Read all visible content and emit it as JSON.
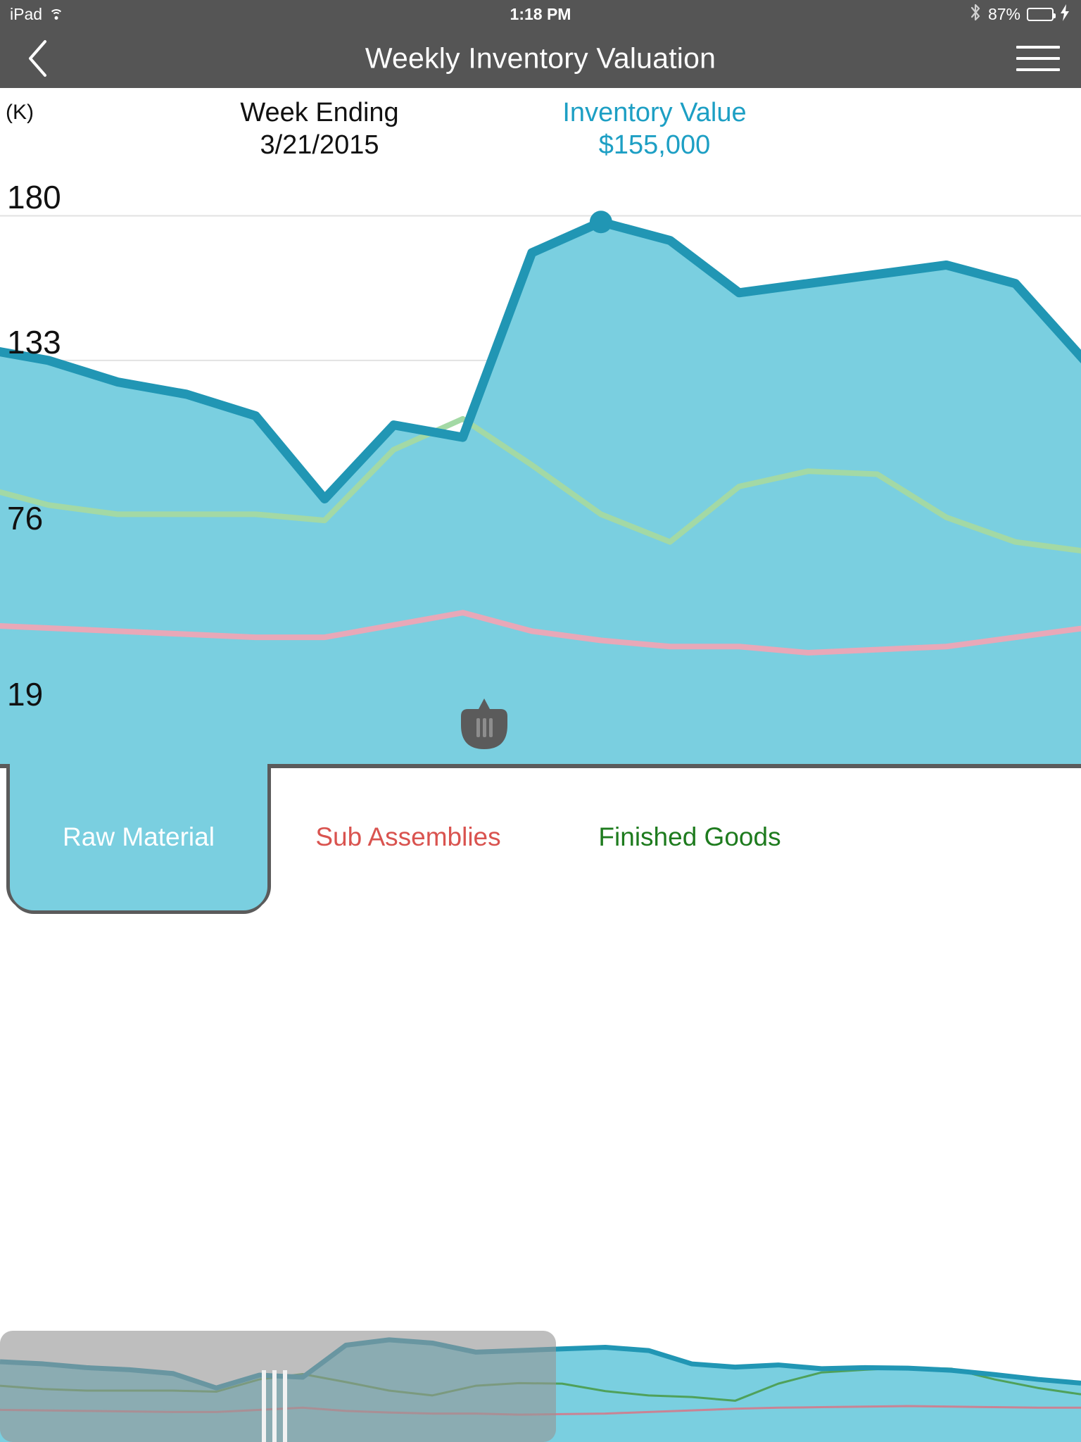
{
  "status_bar": {
    "device": "iPad",
    "wifi_icon": "wifi-icon",
    "time": "1:18 PM",
    "bluetooth_icon": "bluetooth-icon",
    "battery_percent": "87%",
    "battery_level": 87,
    "battery_color": "#4CD964",
    "charging_icon": "lightning-bolt-icon"
  },
  "nav_bar": {
    "back_icon": "chevron-left-icon",
    "title": "Weekly Inventory Valuation",
    "menu_icon": "hamburger-menu-icon",
    "background": "#555555"
  },
  "readout": {
    "axis_unit": "(K)",
    "date_label": "Week Ending",
    "date_value": "3/21/2015",
    "value_label": "Inventory Value",
    "value_amount": "$155,000",
    "value_color": "#1D9FC4"
  },
  "tabs": [
    {
      "id": "raw-material",
      "label": "Raw Material",
      "color": "#FFFFFF",
      "active": true
    },
    {
      "id": "sub-assemblies",
      "label": "Sub Assemblies",
      "color": "#D9534F",
      "active": false
    },
    {
      "id": "finished-goods",
      "label": "Finished Goods",
      "color": "#1E7B1E",
      "active": false
    }
  ],
  "drag_handle": {
    "icon": "drag-handle-shield-icon",
    "grip_lines": 3
  },
  "minimap": {
    "selection_start_pct": 0,
    "selection_end_pct": 51.4,
    "grip_icon": "scrubber-grip-icon",
    "grip_position_pct": 25.4
  },
  "chart_data": {
    "type": "area",
    "title": "Weekly Inventory Valuation",
    "xlabel": "",
    "ylabel": "(K)",
    "ylim": [
      0,
      195
    ],
    "yticks": [
      180,
      133,
      76,
      19
    ],
    "grid": true,
    "legend_position": "bottom",
    "selected_point": {
      "index": 9,
      "series": "Raw Material",
      "date": "3/21/2015",
      "value": 155
    },
    "colors": {
      "raw_material_fill": "#7ACFE0",
      "raw_material_stroke": "#2196B4",
      "finished_goods_stroke": "#A3D9A5",
      "sub_assemblies_stroke": "#E8A8B8",
      "gridline": "#E2E2E2"
    },
    "series": [
      {
        "name": "Raw Material",
        "stroke": "#2196B4",
        "fill": "#7ACFE0",
        "values": [
          137,
          133,
          126,
          122,
          115,
          88,
          112,
          108,
          168,
          178,
          172,
          155,
          158,
          161,
          164,
          158,
          133,
          127,
          131,
          124,
          126,
          125,
          121,
          113,
          104,
          97
        ]
      },
      {
        "name": "Finished Goods",
        "stroke": "#A3D9A5",
        "values": [
          92,
          86,
          83,
          83,
          83,
          81,
          104,
          114,
          99,
          83,
          74,
          92,
          97,
          96,
          82,
          74,
          71,
          64,
          96,
          117,
          122,
          126,
          124,
          104,
          88,
          76
        ]
      },
      {
        "name": "Sub Assemblies",
        "stroke": "#E8A8B8",
        "values": [
          47,
          46,
          45,
          44,
          43,
          43,
          47,
          51,
          45,
          42,
          40,
          40,
          38,
          39,
          40,
          43,
          46,
          49,
          51,
          52,
          53,
          54,
          53,
          52,
          51,
          51
        ]
      }
    ]
  }
}
